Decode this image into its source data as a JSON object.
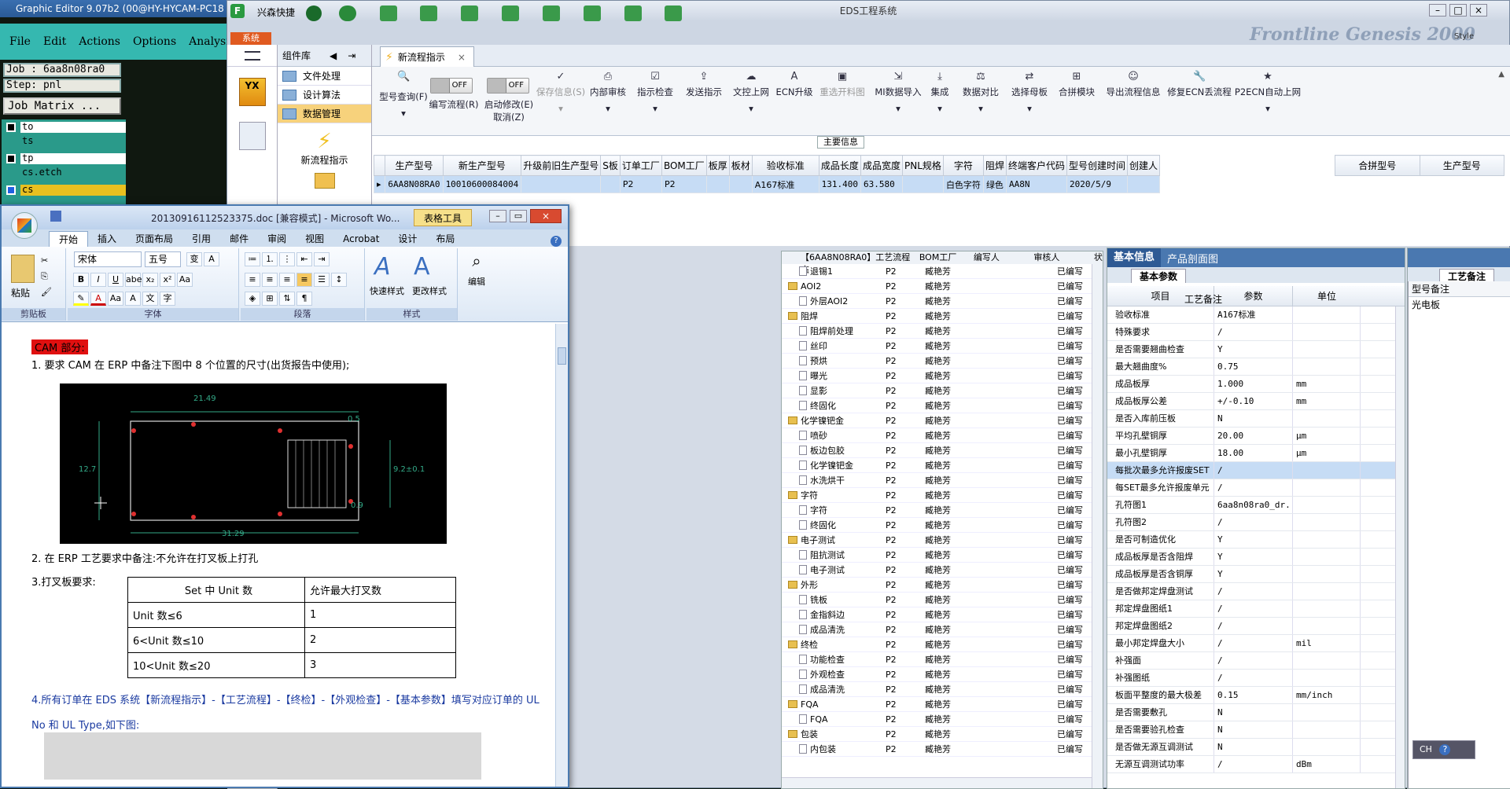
{
  "graphic_editor": {
    "title": "Graphic Editor 9.07b2 (00@HY-HYCAM-PC18",
    "menu": [
      "File",
      "Edit",
      "Actions",
      "Options",
      "Analysis"
    ],
    "job": "Job : 6aa8n08ra0",
    "step": "Step: pnl",
    "job_matrix": "Job Matrix ...",
    "layers": [
      {
        "name": "to",
        "color": "#ffffff"
      },
      {
        "name": "ts",
        "color": "#2a9a8a"
      },
      {
        "name": "tp",
        "color": "#ffffff"
      },
      {
        "name": "cs.etch",
        "color": "#2a9a8a"
      },
      {
        "name": "cs",
        "color": "#e8c020"
      }
    ]
  },
  "eds": {
    "title": "EDS工程系统",
    "quick_label": "兴森快捷",
    "sys_label": "系统",
    "menu_label": "菜单",
    "brand": "Frontline Genesis 2000",
    "style_label": "Style",
    "nav": {
      "header": "组件库",
      "items": [
        "文件处理",
        "设计算法",
        "数据管理"
      ],
      "launch": "新流程指示"
    },
    "tab": "新流程指示",
    "toggles": [
      {
        "label": "编写流程(R)",
        "state": "OFF"
      },
      {
        "label": "启动修改(E)",
        "state": "OFF",
        "sub": "取消(Z)"
      }
    ],
    "tools": [
      {
        "label": "型号查询(F)",
        "icon": "search-icon",
        "disabled": false
      },
      {
        "label": "保存信息(S)",
        "icon": "check-icon",
        "disabled": true
      },
      {
        "label": "内部审核",
        "icon": "printer-icon",
        "disabled": false
      },
      {
        "label": "指示检查",
        "icon": "checklist-icon",
        "disabled": false
      },
      {
        "label": "发送指示",
        "icon": "upload-icon",
        "disabled": false
      },
      {
        "label": "文控上网",
        "icon": "cloud-icon",
        "disabled": false
      },
      {
        "label": "ECN升级",
        "icon": "ecn-icon",
        "disabled": false
      },
      {
        "label": "重选开料图",
        "icon": "image-icon",
        "disabled": true
      },
      {
        "label": "MI数据导入",
        "icon": "import-icon",
        "disabled": false
      },
      {
        "label": "集成",
        "icon": "download-icon",
        "disabled": false
      },
      {
        "label": "数据对比",
        "icon": "compare-icon",
        "disabled": false
      },
      {
        "label": "选择母板",
        "icon": "shuffle-icon",
        "disabled": false
      },
      {
        "label": "合拼模块",
        "icon": "merge-icon",
        "disabled": false
      },
      {
        "label": "导出流程信息",
        "icon": "export-icon",
        "disabled": false
      },
      {
        "label": "修复ECN丢流程",
        "icon": "wrench-icon",
        "disabled": false
      },
      {
        "label": "P2ECN自动上网",
        "icon": "star-icon",
        "disabled": false
      }
    ],
    "main_info_label": "主要信息",
    "main_columns": [
      "生产型号",
      "新生产型号",
      "升级前旧生产型号",
      "S板",
      "订单工厂",
      "BOM工厂",
      "板厚",
      "板材",
      "验收标准",
      "成品长度",
      "成品宽度",
      "PNL规格",
      "字符",
      "阻焊",
      "终端客户代码",
      "型号创建时间",
      "创建人"
    ],
    "main_row": [
      "6AA8N08RA0",
      "10010600084004",
      "",
      "",
      "P2",
      "P2",
      "",
      "",
      "A167标准",
      "131.400",
      "63.580",
      "",
      "白色字符",
      "绿色",
      "AA8N",
      "2020/5/9",
      ""
    ],
    "side_columns": [
      "合拼型号",
      "生产型号"
    ],
    "process": {
      "title": "【6AA8N08RA0】工艺流程",
      "columns": [
        "BOM工厂",
        "编写人",
        "审核人",
        "状态"
      ],
      "rows": [
        {
          "name": "退锡1",
          "type": "doc",
          "bom": "P2",
          "writer": "臧艳芳",
          "status": "已编写"
        },
        {
          "name": "AOI2",
          "type": "folder",
          "bom": "P2",
          "writer": "臧艳芳",
          "status": "已编写"
        },
        {
          "name": "外层AOI2",
          "type": "doc",
          "bom": "P2",
          "writer": "臧艳芳",
          "status": "已编写"
        },
        {
          "name": "阻焊",
          "type": "folder",
          "bom": "P2",
          "writer": "臧艳芳",
          "status": "已编写"
        },
        {
          "name": "阻焊前处理",
          "type": "doc",
          "bom": "P2",
          "writer": "臧艳芳",
          "status": "已编写"
        },
        {
          "name": "丝印",
          "type": "doc",
          "bom": "P2",
          "writer": "臧艳芳",
          "status": "已编写"
        },
        {
          "name": "预烘",
          "type": "doc",
          "bom": "P2",
          "writer": "臧艳芳",
          "status": "已编写"
        },
        {
          "name": "曝光",
          "type": "doc",
          "bom": "P2",
          "writer": "臧艳芳",
          "status": "已编写"
        },
        {
          "name": "显影",
          "type": "doc",
          "bom": "P2",
          "writer": "臧艳芳",
          "status": "已编写"
        },
        {
          "name": "终固化",
          "type": "doc",
          "bom": "P2",
          "writer": "臧艳芳",
          "status": "已编写"
        },
        {
          "name": "化学镍钯金",
          "type": "folder",
          "bom": "P2",
          "writer": "臧艳芳",
          "status": "已编写"
        },
        {
          "name": "喷砂",
          "type": "doc",
          "bom": "P2",
          "writer": "臧艳芳",
          "status": "已编写"
        },
        {
          "name": "板边包胶",
          "type": "doc",
          "bom": "P2",
          "writer": "臧艳芳",
          "status": "已编写"
        },
        {
          "name": "化学镍钯金",
          "type": "doc",
          "bom": "P2",
          "writer": "臧艳芳",
          "status": "已编写"
        },
        {
          "name": "水洗烘干",
          "type": "doc",
          "bom": "P2",
          "writer": "臧艳芳",
          "status": "已编写"
        },
        {
          "name": "字符",
          "type": "folder",
          "bom": "P2",
          "writer": "臧艳芳",
          "status": "已编写"
        },
        {
          "name": "字符",
          "type": "doc",
          "bom": "P2",
          "writer": "臧艳芳",
          "status": "已编写"
        },
        {
          "name": "终固化",
          "type": "doc",
          "bom": "P2",
          "writer": "臧艳芳",
          "status": "已编写"
        },
        {
          "name": "电子测试",
          "type": "folder",
          "bom": "P2",
          "writer": "臧艳芳",
          "status": "已编写"
        },
        {
          "name": "阻抗测试",
          "type": "doc",
          "bom": "P2",
          "writer": "臧艳芳",
          "status": "已编写"
        },
        {
          "name": "电子测试",
          "type": "doc",
          "bom": "P2",
          "writer": "臧艳芳",
          "status": "已编写"
        },
        {
          "name": "外形",
          "type": "folder",
          "bom": "P2",
          "writer": "臧艳芳",
          "status": "已编写"
        },
        {
          "name": "铣板",
          "type": "doc",
          "bom": "P2",
          "writer": "臧艳芳",
          "status": "已编写"
        },
        {
          "name": "金指斜边",
          "type": "doc",
          "bom": "P2",
          "writer": "臧艳芳",
          "status": "已编写"
        },
        {
          "name": "成品清洗",
          "type": "doc",
          "bom": "P2",
          "writer": "臧艳芳",
          "status": "已编写"
        },
        {
          "name": "终检",
          "type": "folder",
          "bom": "P2",
          "writer": "臧艳芳",
          "status": "已编写"
        },
        {
          "name": "功能检查",
          "type": "doc",
          "bom": "P2",
          "writer": "臧艳芳",
          "status": "已编写"
        },
        {
          "name": "外观检查",
          "type": "doc",
          "bom": "P2",
          "writer": "臧艳芳",
          "status": "已编写"
        },
        {
          "name": "成品清洗",
          "type": "doc",
          "bom": "P2",
          "writer": "臧艳芳",
          "status": "已编写"
        },
        {
          "name": "FQA",
          "type": "folder",
          "bom": "P2",
          "writer": "臧艳芳",
          "status": "已编写"
        },
        {
          "name": "FQA",
          "type": "doc",
          "bom": "P2",
          "writer": "臧艳芳",
          "status": "已编写"
        },
        {
          "name": "包装",
          "type": "folder",
          "bom": "P2",
          "writer": "臧艳芳",
          "status": "已编写"
        },
        {
          "name": "内包装",
          "type": "doc",
          "bom": "P2",
          "writer": "臧艳芳",
          "status": "已编写"
        }
      ]
    },
    "basic": {
      "tabs": [
        "基本信息",
        "产品剖面图"
      ],
      "sub_tab": "基本参数",
      "columns": [
        "项目",
        "参数",
        "单位"
      ],
      "rows": [
        [
          "验收标准",
          "A167标准",
          ""
        ],
        [
          "特殊要求",
          "/",
          ""
        ],
        [
          "是否需要翘曲检查",
          "Y",
          ""
        ],
        [
          "最大翘曲度%",
          "0.75",
          ""
        ],
        [
          "成品板厚",
          "1.000",
          "mm"
        ],
        [
          "成品板厚公差",
          "+/-0.10",
          "mm"
        ],
        [
          "是否入库前压板",
          "N",
          ""
        ],
        [
          "平均孔壁铜厚",
          "20.00",
          "μm"
        ],
        [
          "最小孔壁铜厚",
          "18.00",
          "μm"
        ],
        [
          "每批次最多允许报废SET",
          "/",
          ""
        ],
        [
          "每SET最多允许报废单元",
          "/",
          ""
        ],
        [
          "孔符图1",
          "6aa8n08ra0_dr...",
          ""
        ],
        [
          "孔符图2",
          "/",
          ""
        ],
        [
          "是否可制造优化",
          "Y",
          ""
        ],
        [
          "成品板厚是否含阻焊",
          "Y",
          ""
        ],
        [
          "成品板厚是否含铜厚",
          "Y",
          ""
        ],
        [
          "是否做邦定焊盘测试",
          "/",
          ""
        ],
        [
          "邦定焊盘图纸1",
          "/",
          ""
        ],
        [
          "邦定焊盘图纸2",
          "/",
          ""
        ],
        [
          "最小邦定焊盘大小",
          "/",
          "mil"
        ],
        [
          "补强面",
          "/",
          ""
        ],
        [
          "补强图纸",
          "/",
          ""
        ],
        [
          "板面平整度的最大极差",
          "0.15",
          "mm/inch"
        ],
        [
          "是否需要敷孔",
          "N",
          ""
        ],
        [
          "是否需要验孔检查",
          "N",
          ""
        ],
        [
          "是否做无源互调测试",
          "N",
          ""
        ],
        [
          "无源互调测试功率",
          "/",
          "dBm"
        ]
      ]
    },
    "remark": {
      "title": "工艺备注",
      "columns": [
        "工艺备注",
        "型号备注"
      ],
      "model_remark": "光电板"
    }
  },
  "word": {
    "title": "20130916112523375.doc [兼容模式] - Microsoft Wo...",
    "context_tab": "表格工具",
    "tabs": [
      "开始",
      "插入",
      "页面布局",
      "引用",
      "邮件",
      "审阅",
      "视图",
      "Acrobat",
      "设计",
      "布局"
    ],
    "font_name": "宋体",
    "font_size": "五号",
    "groups": [
      "剪贴板",
      "字体",
      "段落",
      "样式"
    ],
    "paste_label": "粘贴",
    "quick_style": "快速样式",
    "change_style": "更改样式",
    "edit_label": "编辑",
    "heading": "CAM 部分:",
    "line1": "1.    要求 CAM 在 ERP 中备注下图中 8 个位置的尺寸(出货报告中使用);",
    "line2": "2.  在 ERP 工艺要求中备注:不允许在打叉板上打孔",
    "line3": "3.打叉板要求:",
    "table_header": [
      "Set 中 Unit 数",
      "允许最大打叉数"
    ],
    "table_rows": [
      [
        "Unit 数≤6",
        "1"
      ],
      [
        "6<Unit 数≤10",
        "2"
      ],
      [
        "10<Unit 数≤20",
        "3"
      ]
    ],
    "line4": "4.所有订单在 EDS 系统【新流程指示】-【工艺流程】-【终检】-【外观检查】-【基本参数】填写对应订单的 UL",
    "line5": "No 和 UL Type,如下图:",
    "cad_dims": [
      "21.49",
      "0.5",
      "12.7",
      "9.2±0.1",
      "0.9",
      "31.29"
    ]
  },
  "ime": "CH"
}
